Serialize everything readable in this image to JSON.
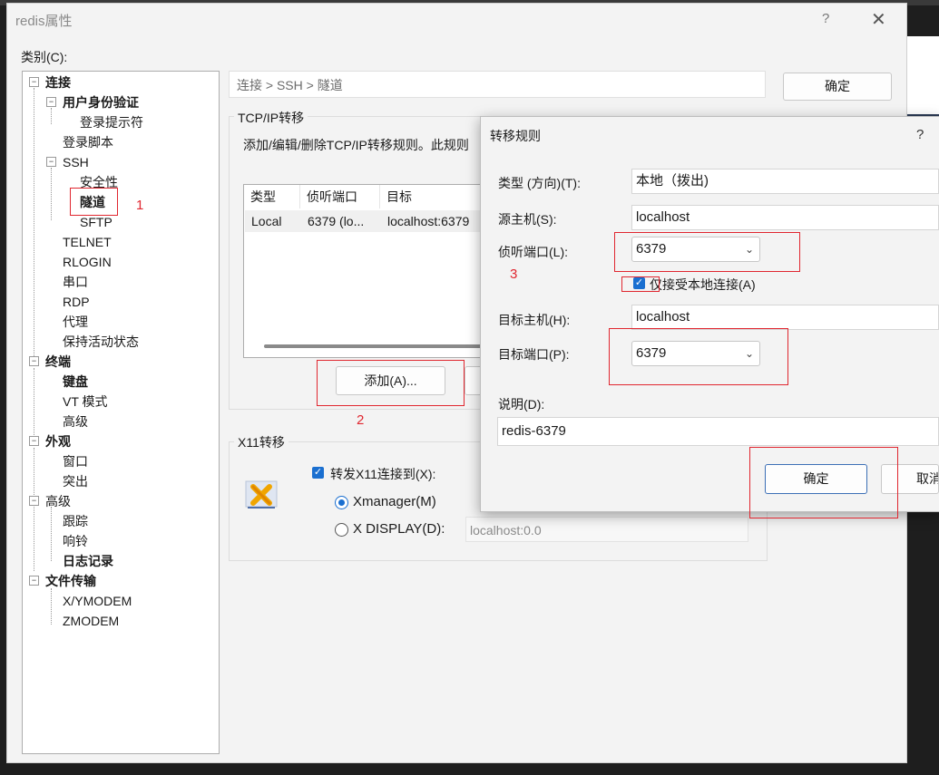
{
  "window": {
    "title": "redis属性",
    "help": "?",
    "close": "✕"
  },
  "category_label": "类别(C):",
  "tree": [
    {
      "label": "连接",
      "bold": true
    },
    {
      "label": "用户身份验证",
      "bold": true
    },
    {
      "label": "登录提示符",
      "bold": false
    },
    {
      "label": "登录脚本",
      "bold": false
    },
    {
      "label": "SSH",
      "bold": false
    },
    {
      "label": "安全性",
      "bold": false
    },
    {
      "label": "隧道",
      "bold": true
    },
    {
      "label": "SFTP",
      "bold": false
    },
    {
      "label": "TELNET",
      "bold": false
    },
    {
      "label": "RLOGIN",
      "bold": false
    },
    {
      "label": "串口",
      "bold": false
    },
    {
      "label": "RDP",
      "bold": false
    },
    {
      "label": "代理",
      "bold": false
    },
    {
      "label": "保持活动状态",
      "bold": false
    },
    {
      "label": "终端",
      "bold": true
    },
    {
      "label": "键盘",
      "bold": true
    },
    {
      "label": "VT 模式",
      "bold": false
    },
    {
      "label": "高级",
      "bold": false
    },
    {
      "label": "外观",
      "bold": true
    },
    {
      "label": "窗口",
      "bold": false
    },
    {
      "label": "突出",
      "bold": false
    },
    {
      "label": "高级",
      "bold": false
    },
    {
      "label": "跟踪",
      "bold": false
    },
    {
      "label": "响铃",
      "bold": false
    },
    {
      "label": "日志记录",
      "bold": true
    },
    {
      "label": "文件传输",
      "bold": true
    },
    {
      "label": "X/YMODEM",
      "bold": false
    },
    {
      "label": "ZMODEM",
      "bold": false
    }
  ],
  "breadcrumb": "连接 > SSH > 隧道",
  "ok_button": "确定",
  "tcp": {
    "group_title": "TCP/IP转移",
    "description": "添加/编辑/删除TCP/IP转移规则。此规则",
    "columns": [
      "类型",
      "侦听端口",
      "目标"
    ],
    "rows": [
      [
        "Local",
        "6379 (lo...",
        "localhost:6379"
      ]
    ],
    "add_button": "添加(A)..."
  },
  "x11": {
    "group_title": "X11转移",
    "forward_label": "转发X11连接到(X):",
    "xmanager_label": "Xmanager(M)",
    "xdisplay_label": "X DISPLAY(D):",
    "xdisplay_value": "localhost:0.0"
  },
  "rule_dialog": {
    "title": "转移规则",
    "help": "?",
    "type_label": "类型 (方向)(T):",
    "type_value": "本地（拨出)",
    "source_host_label": "源主机(S):",
    "source_host_value": "localhost",
    "listen_port_label": "侦听端口(L):",
    "listen_port_value": "6379",
    "local_only_label": "仅接受本地连接(A)",
    "target_host_label": "目标主机(H):",
    "target_host_value": "localhost",
    "target_port_label": "目标端口(P):",
    "target_port_value": "6379",
    "desc_label": "说明(D):",
    "desc_value": "redis-6379",
    "ok": "确定",
    "cancel": "取消"
  },
  "annotations": {
    "one": "1",
    "two": "2",
    "three": "3"
  },
  "colors": {
    "annotation_red": "#e0262f",
    "accent_blue": "#1a6fd0"
  }
}
